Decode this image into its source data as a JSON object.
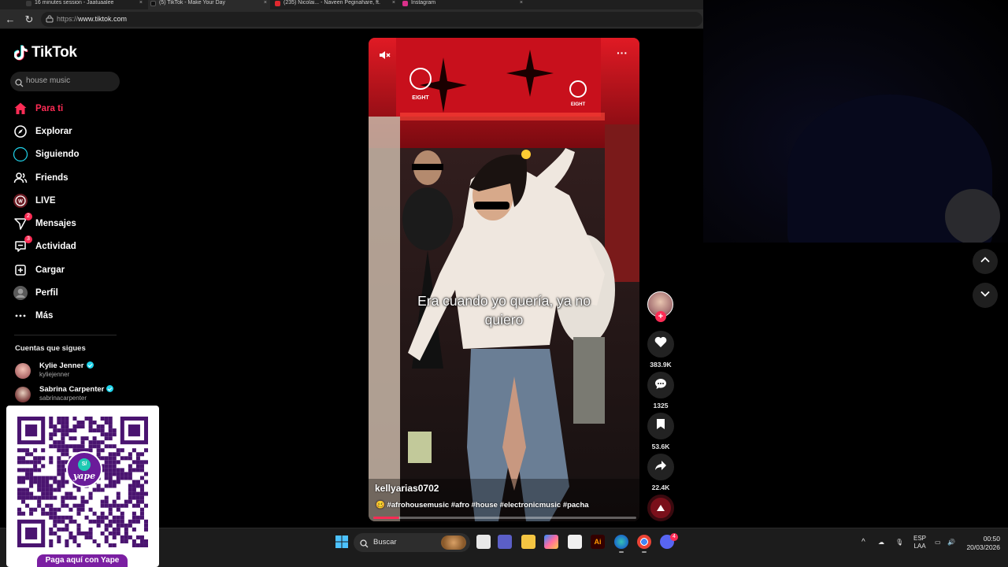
{
  "browser": {
    "tabs": [
      {
        "title": "16 minutes session - Jaatuaalee",
        "color": "#3a3a3a"
      },
      {
        "title": "(5) TikTok - Make Your Day",
        "color": "#111111"
      },
      {
        "title": "(235) Nicolai... - Naveen Peginahare, ft.",
        "color": "#e0282e"
      },
      {
        "title": "Instagram",
        "color": "#d9308a"
      }
    ],
    "url_prefix": "https://",
    "url_host": "www.tiktok.com"
  },
  "tiktok": {
    "logo": "TikTok",
    "search_value": "house music",
    "menu": [
      {
        "label": "Para ti",
        "icon": "home-icon",
        "active": true
      },
      {
        "label": "Explorar",
        "icon": "compass-icon",
        "active": false
      },
      {
        "label": "Siguiendo",
        "icon": "following-icon",
        "active": false
      },
      {
        "label": "Friends",
        "icon": "friends-icon",
        "active": false
      },
      {
        "label": "LIVE",
        "icon": "live-icon",
        "active": false
      },
      {
        "label": "Mensajes",
        "icon": "messages-icon",
        "active": false,
        "badge": "2"
      },
      {
        "label": "Actividad",
        "icon": "activity-icon",
        "active": false,
        "badge": "3"
      },
      {
        "label": "Cargar",
        "icon": "upload-icon",
        "active": false
      },
      {
        "label": "Perfil",
        "icon": "profile-icon",
        "active": false
      },
      {
        "label": "Más",
        "icon": "more-icon",
        "active": false
      }
    ],
    "following_title": "Cuentas que sigues",
    "following": [
      {
        "name": "Kylie Jenner",
        "handle": "kyliejenner",
        "verified": true
      },
      {
        "name": "Sabrina Carpenter",
        "handle": "sabrinacarpenter",
        "verified": true
      }
    ]
  },
  "video": {
    "caption": "Era cuando yo quería, ya no quiero",
    "username": "kellyarias0702",
    "hashtags": "🥴 #afrohousemusic #afro #house #electronicmusic #pacha",
    "progress_percent": 10,
    "likes": "383.9K",
    "comments": "1325",
    "saves": "53.6K",
    "shares": "22.4K",
    "sign_text": "EIGHT"
  },
  "qr": {
    "button_label": "Paga aquí con Yape",
    "logo_text": "yape",
    "logo_symbol": "S/"
  },
  "taskbar": {
    "search_label": "Buscar",
    "lang_top": "ESP",
    "lang_bottom": "LAA",
    "time": "00:50",
    "date": "20/03/2026",
    "discord_badge": "4"
  },
  "colors": {
    "accent": "#fe2c55",
    "verified": "#20d5ec",
    "yape": "#6a1b9a"
  }
}
